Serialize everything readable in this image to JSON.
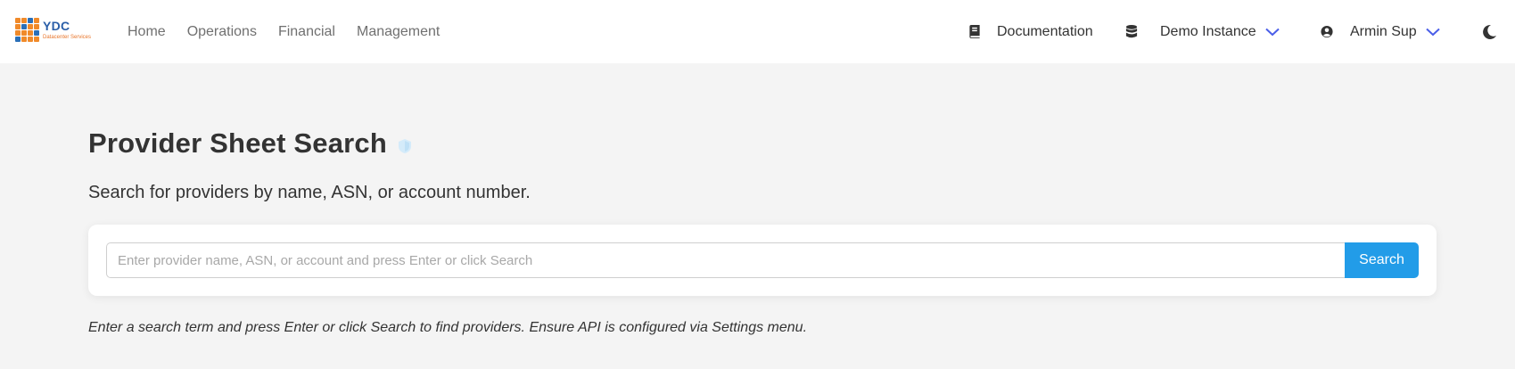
{
  "logo": {
    "title": "YDC",
    "subtitle": "Datacenter Services",
    "colors": {
      "orange": "#f08a2a",
      "blue": "#2a6fb8"
    }
  },
  "nav": {
    "links": [
      "Home",
      "Operations",
      "Financial",
      "Management"
    ],
    "documentation_label": "Documentation",
    "instance_label": "Demo Instance",
    "user_label": "Armin Sup",
    "icons": {
      "documentation": "book-icon",
      "instance": "database-icon",
      "user": "user-circle-icon",
      "theme": "moon-icon",
      "dropdown": "chevron-down-icon"
    },
    "chevron_color": "#4a5ee8"
  },
  "page": {
    "title": "Provider Sheet Search",
    "subtitle": "Search for providers by name, ASN, or account number.",
    "title_icon": "shield-icon"
  },
  "search": {
    "placeholder": "Enter provider name, ASN, or account and press Enter or click Search",
    "value": "",
    "button_label": "Search",
    "button_color": "#229ce8"
  },
  "hint": "Enter a search term and press Enter or click Search to find providers. Ensure API is configured via Settings menu."
}
